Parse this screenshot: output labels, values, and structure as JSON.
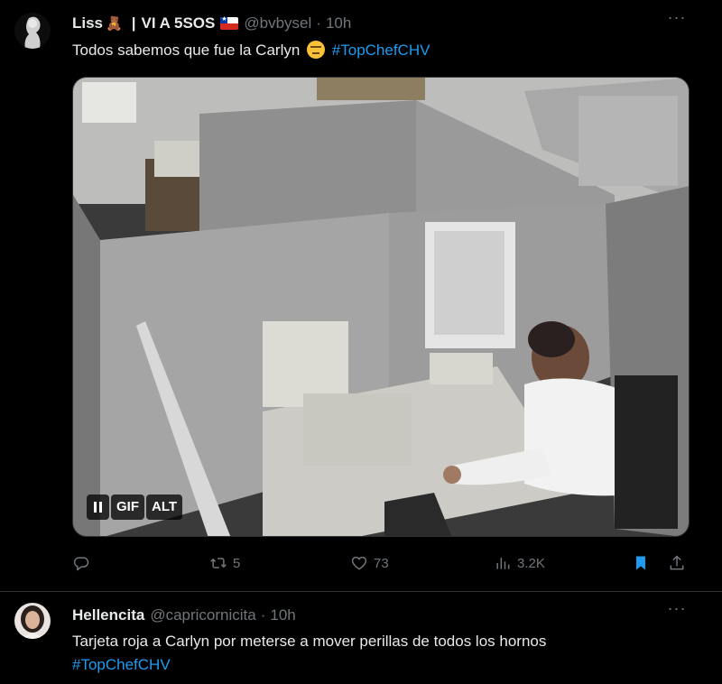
{
  "tweet1": {
    "display_name": "Liss",
    "bear_emoji": "🧸",
    "separator": "|",
    "name_suffix": "VI A 5SOS",
    "handle": "@bvbysel",
    "dot": "·",
    "time": "10h",
    "text_before": "Todos sabemos que fue la Carlyn",
    "hashtag": "#TopChefCHV",
    "media_controls": {
      "gif_label": "GIF",
      "alt_label": "ALT"
    },
    "actions": {
      "retweets": "5",
      "likes": "73",
      "views": "3.2K"
    },
    "more": "···"
  },
  "tweet2": {
    "display_name": "Hellencita",
    "handle": "@capricornicita",
    "dot": "·",
    "time": "10h",
    "text": "Tarjeta roja a Carlyn por meterse a mover perillas de todos los hornos",
    "hashtag": "#TopChefCHV",
    "more": "···"
  },
  "icons": {
    "reply": "reply-icon",
    "retweet": "retweet-icon",
    "like": "heart-icon",
    "views": "views-icon",
    "bookmark": "bookmark-icon",
    "share": "share-icon",
    "pause": "pause-icon"
  },
  "colors": {
    "background": "#000000",
    "text": "#e7e9ea",
    "muted": "#71767b",
    "accent": "#1d9bf0",
    "divider": "#2f3336"
  }
}
